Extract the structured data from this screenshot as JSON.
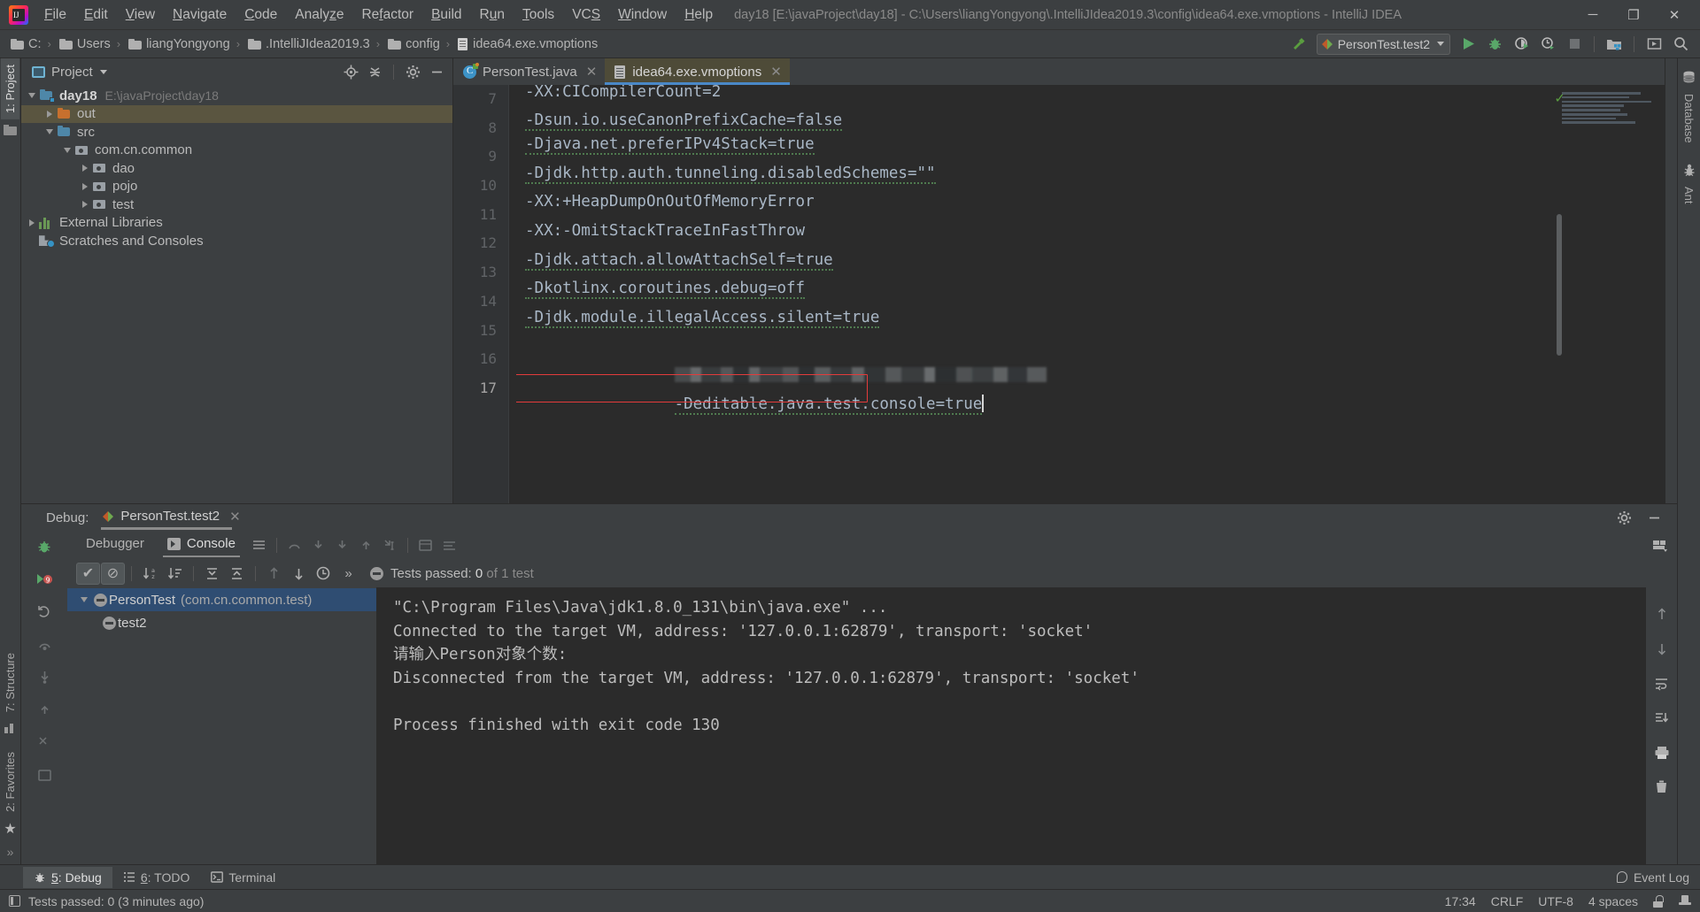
{
  "window": {
    "title": "day18 [E:\\javaProject\\day18] - C:\\Users\\liangYongyong\\.IntelliJIdea2019.3\\config\\idea64.exe.vmoptions - IntelliJ IDEA",
    "minimize": "─",
    "maximize": "❐",
    "close": "✕"
  },
  "menu": [
    {
      "label": "File"
    },
    {
      "label": "Edit"
    },
    {
      "label": "View"
    },
    {
      "label": "Navigate"
    },
    {
      "label": "Code"
    },
    {
      "label": "Analyze"
    },
    {
      "label": "Refactor"
    },
    {
      "label": "Build"
    },
    {
      "label": "Run"
    },
    {
      "label": "Tools"
    },
    {
      "label": "VCS"
    },
    {
      "label": "Window"
    },
    {
      "label": "Help"
    }
  ],
  "breadcrumb": [
    {
      "label": "C:",
      "icon": "folder-icon"
    },
    {
      "label": "Users",
      "icon": "folder-icon"
    },
    {
      "label": "liangYongyong",
      "icon": "folder-icon"
    },
    {
      "label": ".IntelliJIdea2019.3",
      "icon": "folder-icon"
    },
    {
      "label": "config",
      "icon": "folder-icon"
    },
    {
      "label": "idea64.exe.vmoptions",
      "icon": "file-icon"
    }
  ],
  "toolbar": {
    "build_icon": "hammer-icon",
    "run_config": "PersonTest.test2",
    "run_icon": "run-icon",
    "debug_icon": "debug-icon",
    "coverage_icon": "run-with-coverage-icon",
    "profile_icon": "profile-icon",
    "stop_icon": "stop-icon",
    "project_structure_icon": "project-structure-icon",
    "updates_icon": "update-icon",
    "search_icon": "search-icon"
  },
  "left_tool_tabs": [
    {
      "label": "1: Project",
      "selected": true
    },
    {
      "label": "7: Structure",
      "selected": false
    },
    {
      "label": "2: Favorites",
      "selected": false
    }
  ],
  "right_tool_tabs": [
    {
      "label": "Database"
    },
    {
      "label": "Ant"
    }
  ],
  "project_panel": {
    "title": "Project",
    "locate_icon": "locate-icon",
    "collapse_icon": "collapse-all-icon",
    "settings_icon": "gear-icon",
    "hide_icon": "hide-icon",
    "tree": [
      {
        "name": "day18",
        "path": "E:\\javaProject\\day18",
        "indent": 0,
        "arrow": "open",
        "icon": "module",
        "bold": true,
        "selected": false
      },
      {
        "name": "out",
        "path": "",
        "indent": 1,
        "arrow": "closed",
        "icon": "folder-orange",
        "bold": false,
        "selected": true
      },
      {
        "name": "src",
        "path": "",
        "indent": 1,
        "arrow": "open",
        "icon": "folder-blue",
        "bold": false,
        "selected": false
      },
      {
        "name": "com.cn.common",
        "path": "",
        "indent": 2,
        "arrow": "open",
        "icon": "package",
        "bold": false,
        "selected": false
      },
      {
        "name": "dao",
        "path": "",
        "indent": 3,
        "arrow": "closed",
        "icon": "package",
        "bold": false,
        "selected": false
      },
      {
        "name": "pojo",
        "path": "",
        "indent": 3,
        "arrow": "closed",
        "icon": "package",
        "bold": false,
        "selected": false
      },
      {
        "name": "test",
        "path": "",
        "indent": 3,
        "arrow": "closed",
        "icon": "package",
        "bold": false,
        "selected": false
      },
      {
        "name": "External Libraries",
        "path": "",
        "indent": 0,
        "arrow": "closed",
        "icon": "library",
        "bold": false,
        "selected": false
      },
      {
        "name": "Scratches and Consoles",
        "path": "",
        "indent": 0,
        "arrow": "none",
        "icon": "scratch",
        "bold": false,
        "selected": false
      }
    ]
  },
  "editor": {
    "tabs": [
      {
        "label": "PersonTest.java",
        "icon": "java-class-icon",
        "active": false
      },
      {
        "label": "idea64.exe.vmoptions",
        "icon": "vmoptions-file-icon",
        "active": true
      }
    ],
    "lines": [
      {
        "num": "7",
        "text": "-XX:CICompilerCount=2",
        "redacted": false,
        "highlight": false,
        "partial": true
      },
      {
        "num": "8",
        "text": "-Dsun.io.useCanonPrefixCache=false",
        "redacted": false,
        "highlight": false,
        "partial": false
      },
      {
        "num": "9",
        "text": "-Djava.net.preferIPv4Stack=true",
        "redacted": false,
        "highlight": false,
        "partial": false
      },
      {
        "num": "10",
        "text": "-Djdk.http.auth.tunneling.disabledSchemes=\"\"",
        "redacted": false,
        "highlight": false,
        "partial": false
      },
      {
        "num": "11",
        "text": "-XX:+HeapDumpOnOutOfMemoryError",
        "redacted": false,
        "highlight": false,
        "partial": false
      },
      {
        "num": "12",
        "text": "-XX:-OmitStackTraceInFastThrow",
        "redacted": false,
        "highlight": false,
        "partial": false
      },
      {
        "num": "13",
        "text": "-Djdk.attach.allowAttachSelf=true",
        "redacted": false,
        "highlight": false,
        "partial": false
      },
      {
        "num": "14",
        "text": "-Dkotlinx.coroutines.debug=off",
        "redacted": false,
        "highlight": false,
        "partial": false
      },
      {
        "num": "15",
        "text": "-Djdk.module.illegalAccess.silent=true",
        "redacted": false,
        "highlight": false,
        "partial": false
      },
      {
        "num": "16",
        "text": "",
        "redacted": true,
        "highlight": false,
        "partial": false
      },
      {
        "num": "17",
        "text": "-Deditable.java.test.console=true",
        "redacted": false,
        "highlight": true,
        "partial": false
      }
    ]
  },
  "debug": {
    "label": "Debug:",
    "session": "PersonTest.test2",
    "close_icon": "close-icon",
    "settings_icon": "gear-icon",
    "hide_icon": "hide-icon",
    "layout_icon": "layout-settings-icon",
    "tabs": [
      {
        "label": "Debugger",
        "icon": "debugger-icon",
        "selected": false
      },
      {
        "label": "Console",
        "icon": "console-icon",
        "selected": true
      }
    ],
    "left_icons": [
      "debug-bug-icon",
      "breakpoints-icon",
      "restore-layout-icon",
      "step-over-icon",
      "step-into-icon",
      "step-out-icon",
      "mute-breakpoints-icon",
      "evaluate-icon"
    ],
    "toolbar_icons": [
      {
        "name": "show-passed-icon",
        "glyph": "✔",
        "state": "on"
      },
      {
        "name": "hide-ignored-icon",
        "glyph": "⊘",
        "state": "on"
      },
      {
        "name": "sort-alphabetically-icon",
        "glyph": "↓",
        "state": "normal"
      },
      {
        "name": "sort-by-duration-icon",
        "glyph": "↓",
        "state": "normal"
      },
      {
        "name": "expand-all-icon",
        "glyph": "⤓",
        "state": "normal"
      },
      {
        "name": "collapse-all-icon",
        "glyph": "⤒",
        "state": "normal"
      },
      {
        "name": "previous-failed-icon",
        "glyph": "↑",
        "state": "dim"
      },
      {
        "name": "next-failed-icon",
        "glyph": "↓",
        "state": "normal"
      },
      {
        "name": "test-history-icon",
        "glyph": "◴",
        "state": "normal"
      },
      {
        "name": "more-options-icon",
        "glyph": "»",
        "state": "normal"
      }
    ],
    "tests_status_prefix": "Tests passed: ",
    "tests_status_count": "0",
    "tests_status_suffix": " of 1 test",
    "tree": [
      {
        "name": "PersonTest",
        "pkg": "(com.cn.common.test)",
        "arrow": "open",
        "indent": 0,
        "selected": true
      },
      {
        "name": "test2",
        "pkg": "",
        "arrow": "none",
        "indent": 1,
        "selected": false
      }
    ],
    "console_lines": [
      {
        "text": "\"C:\\Program Files\\Java\\jdk1.8.0_131\\bin\\java.exe\" ...",
        "kind": "cmd"
      },
      {
        "text": "Connected to the target VM, address: '127.0.0.1:62879', transport: 'socket'",
        "kind": "out"
      },
      {
        "text": "请输入Person对象个数:",
        "kind": "out"
      },
      {
        "text": "Disconnected from the target VM, address: '127.0.0.1:62879', transport: 'socket'",
        "kind": "out"
      },
      {
        "text": "",
        "kind": "out"
      },
      {
        "text": "Process finished with exit code 130",
        "kind": "out"
      }
    ],
    "console_side_icons": [
      "scroll-up-icon",
      "scroll-down-icon",
      "soft-wrap-icon",
      "scroll-to-end-icon",
      "print-icon",
      "clear-all-icon"
    ]
  },
  "bottom_tabs": [
    {
      "label": "5: Debug",
      "icon": "debug-icon",
      "selected": true
    },
    {
      "label": "6: TODO",
      "icon": "todo-icon",
      "selected": false
    },
    {
      "label": "Terminal",
      "icon": "terminal-icon",
      "selected": false
    }
  ],
  "bottom_right": {
    "event_log": "Event Log",
    "event_log_icon": "event-log-icon"
  },
  "statusbar": {
    "message": "Tests passed: 0 (3 minutes ago)",
    "message_icon": "status-window-icon",
    "time": "17:34",
    "line_sep": "CRLF",
    "encoding": "UTF-8",
    "indent": "4 spaces",
    "lock_icon": "lock-icon",
    "inspector_icon": "inspector-hat-icon"
  },
  "colors": {
    "bg": "#3c3f41",
    "editor_bg": "#2b2b2b",
    "accent_blue": "#4a88c7",
    "selection_tan": "#5a5540",
    "tree_selection": "#2f4d72",
    "highlight_red": "#e33b3b",
    "green_run": "#59a869",
    "code_text": "#a9b7c6"
  }
}
